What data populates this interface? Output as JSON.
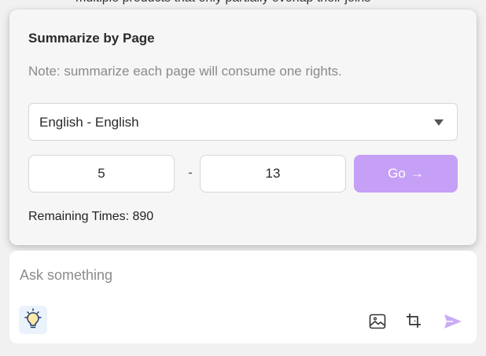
{
  "background": {
    "partial_text": "multiple products that only partially overlap their joins"
  },
  "popup": {
    "title": "Summarize by Page",
    "note": "Note: summarize each page will consume one rights.",
    "language_select": "English - English",
    "page_from": "5",
    "page_separator": "-",
    "page_to": "13",
    "go_label": "Go",
    "go_arrow": "→",
    "remaining_label": "Remaining Times: ",
    "remaining_value": "890"
  },
  "chat": {
    "placeholder": "Ask something",
    "icons": [
      "lightbulb-icon",
      "image-icon",
      "crop-icon",
      "send-icon"
    ]
  },
  "colors": {
    "accent": "#c6a0f6",
    "send": "#c9acf5"
  }
}
